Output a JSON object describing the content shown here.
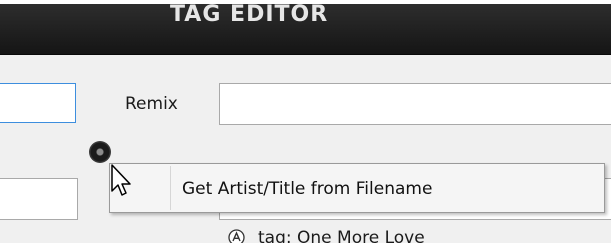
{
  "window": {
    "title": "TAG EDITOR"
  },
  "form": {
    "remix_label": "Remix",
    "remix_value": ""
  },
  "context_menu": {
    "item_label": "Get Artist/Title from Filename"
  },
  "tag_list": {
    "row_text": "tag: One More Love"
  },
  "icons": {
    "record": "record-dot-icon",
    "cursor": "mouse-pointer-icon",
    "tag": "circled-a-icon"
  },
  "colors": {
    "title_bar": "#1f1f1f",
    "title_text": "#e6e6e6",
    "focus_border": "#3d8ede",
    "field_border": "#a9a9a9",
    "background": "#f0f0f0"
  }
}
